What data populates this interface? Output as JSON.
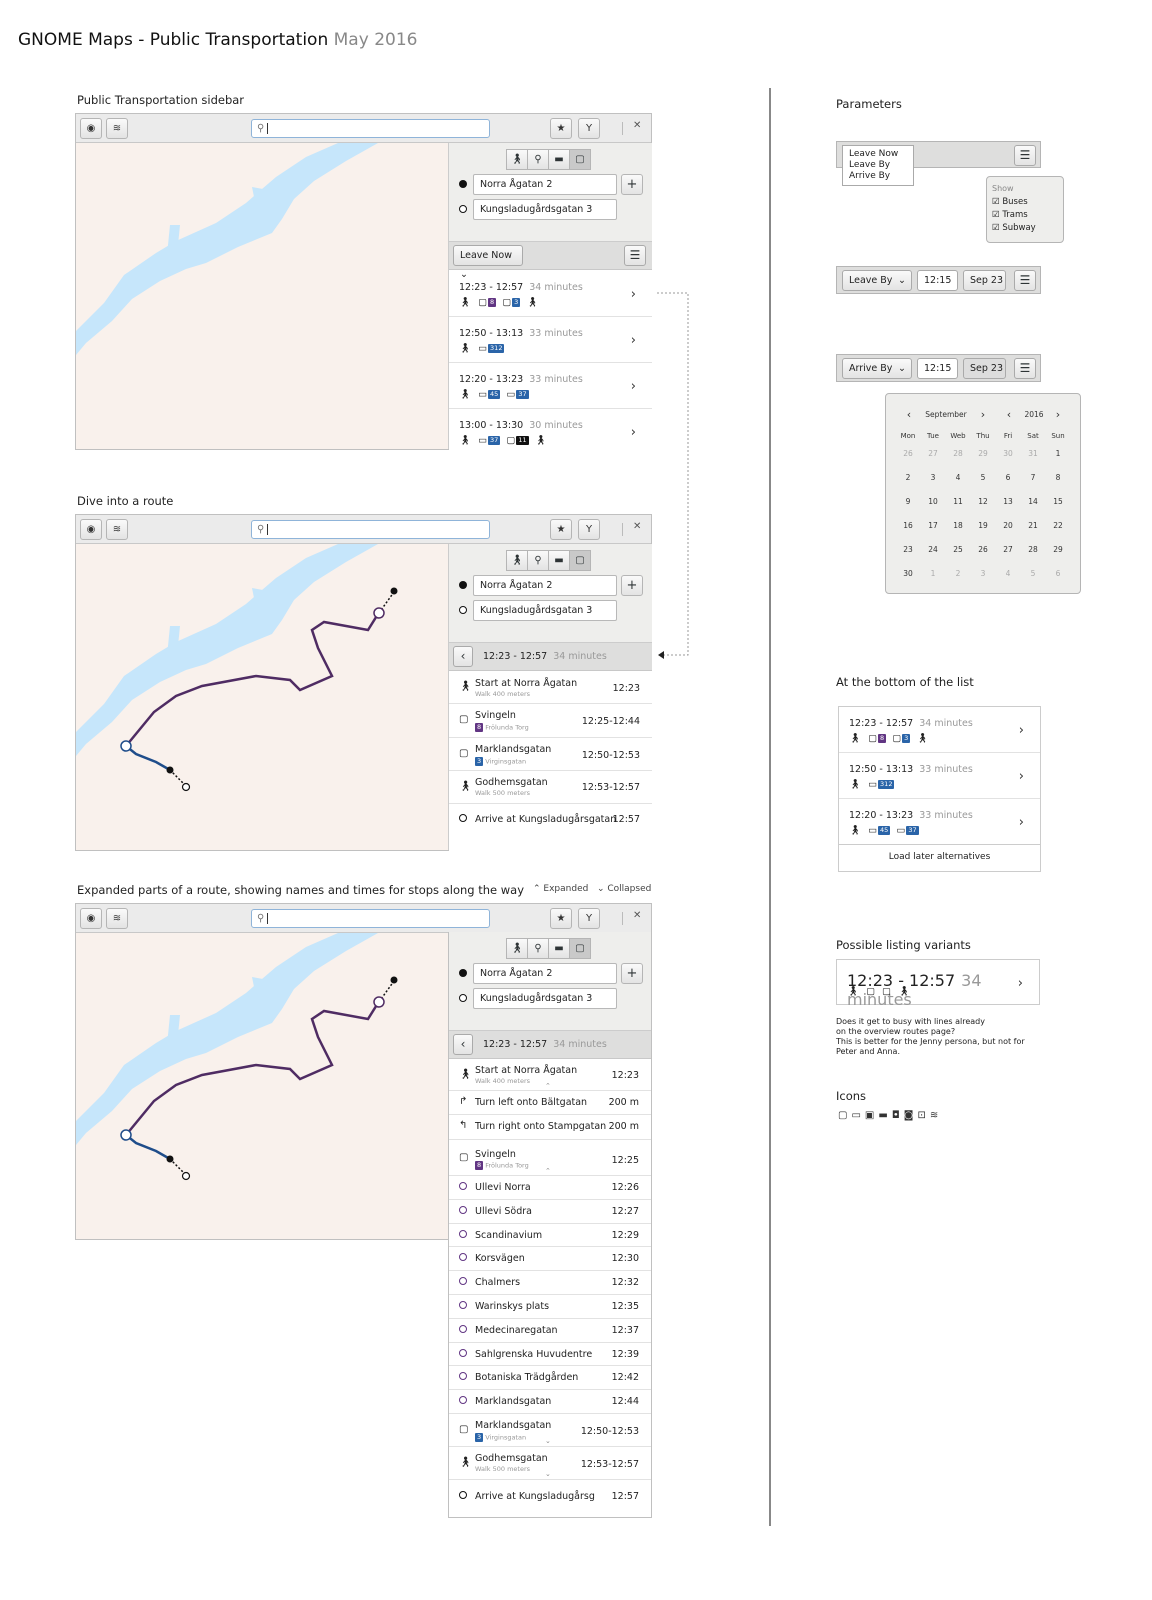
{
  "page": {
    "title": "GNOME Maps - Public Transportation",
    "date": "May 2016"
  },
  "sections": {
    "sidebar": "Public Transportation sidebar",
    "dive": "Dive into a route",
    "expanded": "Expanded parts of a route, showing names and times for stops along the way",
    "expanded_legend": "Expanded",
    "collapsed_legend": "Collapsed",
    "parameters": "Parameters",
    "bottom": "At the bottom of the list",
    "variants": "Possible listing variants",
    "icons": "Icons"
  },
  "route_form": {
    "from": "Norra Ågatan 2",
    "to": "Kungsladugårdsgatan 3",
    "leave_now": "Leave Now"
  },
  "routes": [
    {
      "time": "12:23 - 12:57",
      "duration": "34 minutes",
      "lines": [
        "8",
        "3"
      ]
    },
    {
      "time": "12:50 - 13:13",
      "duration": "33 minutes",
      "lines": [
        "312"
      ]
    },
    {
      "time": "12:20 - 13:23",
      "duration": "33 minutes",
      "lines": [
        "45",
        "37"
      ]
    },
    {
      "time": "13:00 - 13:30",
      "duration": "30 minutes",
      "lines": [
        "37",
        "11"
      ]
    }
  ],
  "dive": {
    "header_time": "12:23 - 12:57",
    "header_duration": "34 minutes",
    "steps": [
      {
        "name": "Start at Norra Ågatan",
        "sub": "Walk 400 meters",
        "time": "12:23"
      },
      {
        "name": "Svingeln",
        "line": "8",
        "sub": "Frölunda Torg",
        "time": "12:25-12:44"
      },
      {
        "name": "Marklandsgatan",
        "line": "3",
        "sub": "Virginsgatan",
        "time": "12:50-12:53"
      },
      {
        "name": "Godhemsgatan",
        "sub": "Walk 500 meters",
        "time": "12:53-12:57"
      },
      {
        "name": "Arrive at Kungsladugårsgatan",
        "time": "12:57"
      }
    ]
  },
  "expanded": {
    "start": {
      "name": "Start at Norra Ågatan",
      "sub": "Walk 400 meters",
      "time": "12:23"
    },
    "turns": [
      {
        "name": "Turn left onto Bältgatan",
        "dist": "200 m"
      },
      {
        "name": "Turn right onto Stampgatan",
        "dist": "200 m"
      }
    ],
    "board": {
      "name": "Svingeln",
      "line": "8",
      "sub": "Frölunda Torg",
      "time": "12:25"
    },
    "stops": [
      {
        "name": "Ullevi Norra",
        "time": "12:26"
      },
      {
        "name": "Ullevi Södra",
        "time": "12:27"
      },
      {
        "name": "Scandinavium",
        "time": "12:29"
      },
      {
        "name": "Korsvägen",
        "time": "12:30"
      },
      {
        "name": "Chalmers",
        "time": "12:32"
      },
      {
        "name": "Warinskys plats",
        "time": "12:35"
      },
      {
        "name": "Medecinaregatan",
        "time": "12:37"
      },
      {
        "name": "Sahlgrenska Huvudentre",
        "time": "12:39"
      },
      {
        "name": "Botaniska Trädgården",
        "time": "12:42"
      },
      {
        "name": "Marklandsgatan",
        "time": "12:44"
      }
    ],
    "transfer": {
      "name": "Marklandsgatan",
      "line": "3",
      "sub": "Virginsgatan",
      "time": "12:50-12:53"
    },
    "walk": {
      "name": "Godhemsgatan",
      "sub": "Walk 500 meters",
      "time": "12:53-12:57"
    },
    "arrive": {
      "name": "Arrive at Kungsladugårsg",
      "time": "12:57"
    }
  },
  "params": {
    "options": [
      "Leave Now",
      "Leave By",
      "Arrive By"
    ],
    "show": "Show",
    "filters": [
      "Buses",
      "Trams",
      "Subway"
    ],
    "leave_by": "Leave By",
    "arrive_by": "Arrive By",
    "time": "12:15",
    "date": "Sep 23",
    "calendar": {
      "month": "September",
      "year": "2016",
      "weekdays": [
        "Mon",
        "Tue",
        "Web",
        "Thu",
        "Fri",
        "Sat",
        "Sun"
      ],
      "weeks": [
        [
          "26",
          "27",
          "28",
          "29",
          "30",
          "31",
          "1"
        ],
        [
          "2",
          "3",
          "4",
          "5",
          "6",
          "7",
          "8"
        ],
        [
          "9",
          "10",
          "11",
          "12",
          "13",
          "14",
          "15"
        ],
        [
          "16",
          "17",
          "18",
          "19",
          "20",
          "21",
          "22"
        ],
        [
          "23",
          "24",
          "25",
          "26",
          "27",
          "28",
          "29"
        ],
        [
          "30",
          "1",
          "2",
          "3",
          "4",
          "5",
          "6"
        ]
      ]
    }
  },
  "bottom": {
    "load_later": "Load later alternatives"
  },
  "variant": {
    "time": "12:23 - 12:57",
    "duration": "34 minutes",
    "note": "Does it get to busy with lines already on the overview routes page? This is better for the Jenny persona, but not for Peter and Anna.",
    "note_lines": [
      "Does it get to busy with lines already",
      "on the overview routes page?",
      "This is better for the Jenny persona, but not for",
      "Peter and Anna."
    ]
  },
  "colors": {
    "water": "#c6e6fb",
    "map_bg": "#f9f1ec",
    "route_purple": "#4f2c63",
    "route_blue": "#1f4d8a"
  }
}
